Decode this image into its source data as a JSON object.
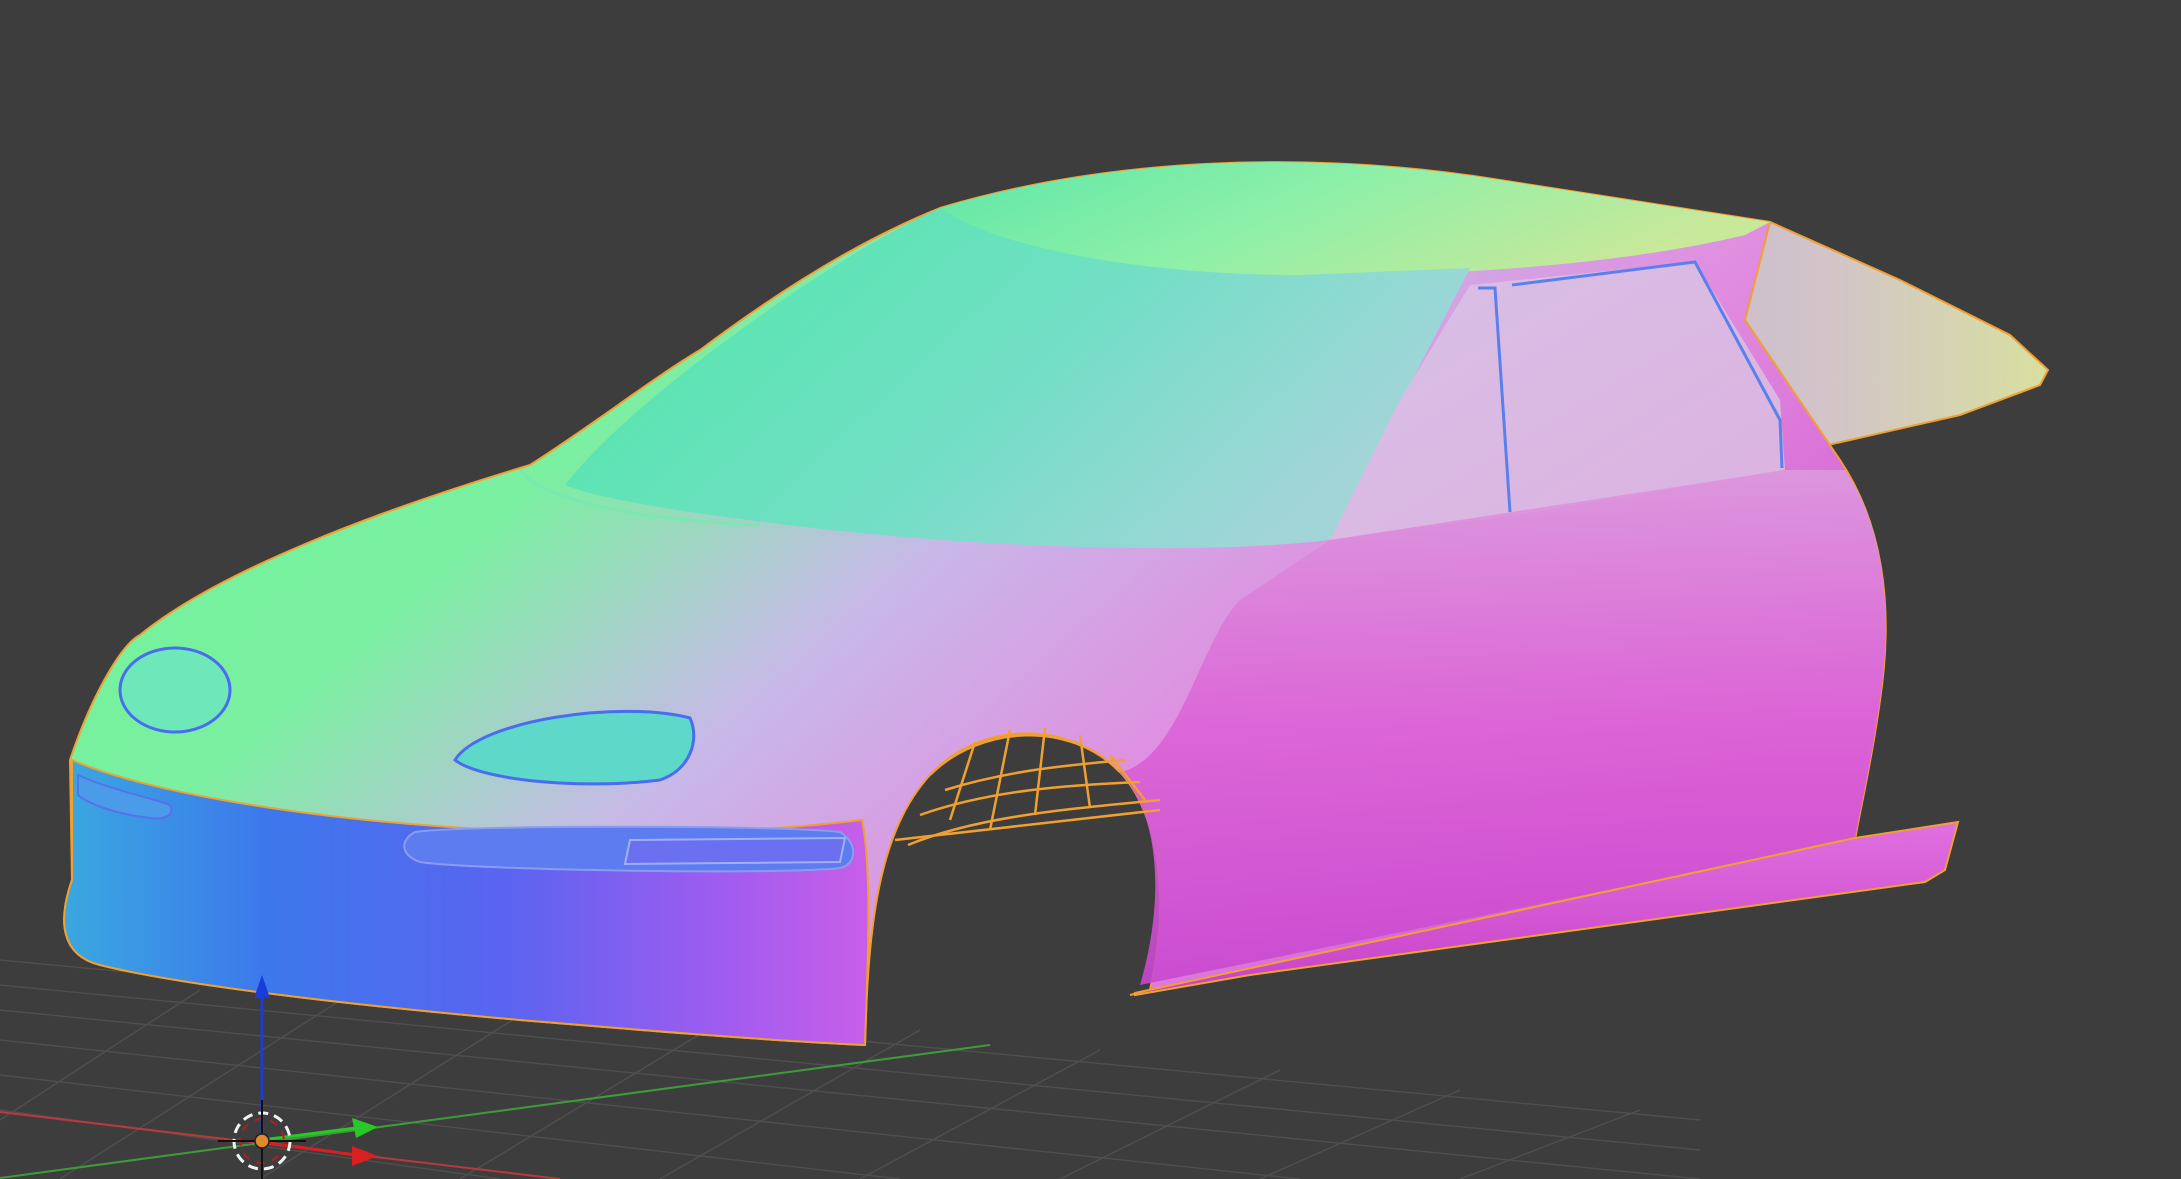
{
  "viewport": {
    "background_color": "#3d3d3d",
    "grid_color": "#4f4f4f",
    "x_axis_color": "#b83a3a",
    "y_axis_color": "#3f9a3a",
    "selection_outline_color": "#f0a030"
  },
  "model": {
    "shading": "normal-map",
    "selected": true,
    "colors": {
      "green": "#6ef59a",
      "cyan": "#5ee6c8",
      "blue": "#4a6cf0",
      "violet": "#9a5cf0",
      "magenta": "#e060d8",
      "pink": "#e6a8e0"
    }
  },
  "gizmo": {
    "icon": "3d-cursor-icon",
    "z_axis_color": "#1a3cd8",
    "y_axis_color": "#28c828",
    "x_axis_color": "#d82020",
    "center_color": "#e08a2a"
  }
}
